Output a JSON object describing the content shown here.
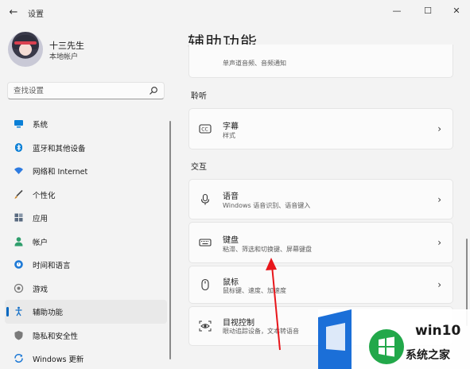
{
  "window": {
    "title": "设置",
    "back_glyph": "←",
    "controls": {
      "minimize": "—",
      "maximize": "☐",
      "close": "✕"
    }
  },
  "profile": {
    "name": "十三先生",
    "account_type": "本地帐户"
  },
  "search": {
    "placeholder": "查找设置"
  },
  "sidebar": {
    "items": [
      {
        "label": "系统",
        "icon": "monitor-icon",
        "color": "#0a7fd6"
      },
      {
        "label": "蓝牙和其他设备",
        "icon": "bluetooth-icon",
        "color": "#0a7fd6"
      },
      {
        "label": "网络和 Internet",
        "icon": "wifi-icon",
        "color": "#2d7be0"
      },
      {
        "label": "个性化",
        "icon": "brush-icon",
        "color": "#d08a2c"
      },
      {
        "label": "应用",
        "icon": "apps-icon",
        "color": "#5a6b80"
      },
      {
        "label": "帐户",
        "icon": "person-icon",
        "color": "#2f9e6c"
      },
      {
        "label": "时间和语言",
        "icon": "globe-clock-icon",
        "color": "#1f7ad6"
      },
      {
        "label": "游戏",
        "icon": "gamepad-icon",
        "color": "#7a7a7a"
      },
      {
        "label": "辅助功能",
        "icon": "accessibility-icon",
        "color": "#1a73c8",
        "active": true
      },
      {
        "label": "隐私和安全性",
        "icon": "shield-icon",
        "color": "#7a7a7a"
      },
      {
        "label": "Windows 更新",
        "icon": "update-icon",
        "color": "#1f7ad6"
      }
    ]
  },
  "main": {
    "title": "辅助功能",
    "partial_card_sub": "单声道音频、音频通知",
    "sections": [
      {
        "label": "聆听",
        "cards": [
          {
            "title": "字幕",
            "subtitle": "样式",
            "icon": "cc-icon"
          }
        ]
      },
      {
        "label": "交互",
        "cards": [
          {
            "title": "语音",
            "subtitle": "Windows 语音识别、语音键入",
            "icon": "microphone-icon"
          },
          {
            "title": "键盘",
            "subtitle": "粘滞、筛选和切换键、屏幕键盘",
            "icon": "keyboard-icon"
          },
          {
            "title": "鼠标",
            "subtitle": "鼠标键、速度、加速度",
            "icon": "mouse-icon"
          },
          {
            "title": "目视控制",
            "subtitle": "眼动追踪设备，文本转语音",
            "icon": "eye-control-icon"
          }
        ]
      }
    ]
  },
  "watermark": {
    "line1": "win10",
    "line2": "系统之家"
  },
  "colors": {
    "accent": "#0067c0",
    "annotation_arrow": "#e8161b",
    "logo_green": "#22a84a"
  }
}
